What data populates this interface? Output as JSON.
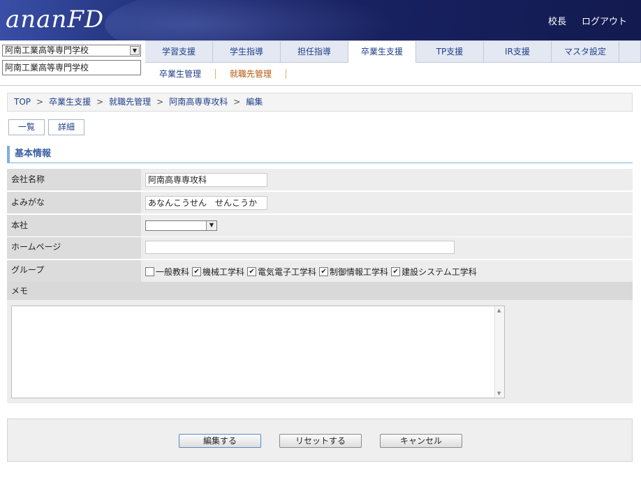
{
  "header": {
    "logo_text": "ananFD",
    "user_role": "校長",
    "logout": "ログアウト"
  },
  "school": {
    "selected": "阿南工業高等専門学校",
    "name_display": "阿南工業高等専門学校"
  },
  "nav": {
    "tabs": [
      {
        "label": "学習支援",
        "active": false
      },
      {
        "label": "学生指導",
        "active": false
      },
      {
        "label": "担任指導",
        "active": false
      },
      {
        "label": "卒業生支援",
        "active": true
      },
      {
        "label": "TP支援",
        "active": false
      },
      {
        "label": "IR支援",
        "active": false
      },
      {
        "label": "マスタ設定",
        "active": false
      }
    ],
    "subnav": [
      {
        "label": "卒業生管理",
        "current": false
      },
      {
        "label": "就職先管理",
        "current": true
      }
    ]
  },
  "breadcrumb": [
    "TOP",
    "卒業生支援",
    "就職先管理",
    "阿南高専専攻科",
    "編集"
  ],
  "view_buttons": {
    "list": "一覧",
    "detail": "詳細"
  },
  "section": {
    "title": "基本情報"
  },
  "form": {
    "company_name": {
      "label": "会社名称",
      "value": "阿南高専専攻科"
    },
    "reading": {
      "label": "よみがな",
      "value": "あなんこうせん　せんこうか"
    },
    "headquarters": {
      "label": "本社",
      "value": ""
    },
    "homepage": {
      "label": "ホームページ",
      "value": ""
    },
    "group": {
      "label": "グループ",
      "options": [
        {
          "label": "一般教科",
          "checked": false
        },
        {
          "label": "機械工学科",
          "checked": true
        },
        {
          "label": "電気電子工学科",
          "checked": true
        },
        {
          "label": "制御情報工学科",
          "checked": true
        },
        {
          "label": "建設システム工学科",
          "checked": true
        }
      ]
    },
    "memo": {
      "label": "メモ",
      "value": ""
    }
  },
  "actions": {
    "edit": "編集する",
    "reset": "リセットする",
    "cancel": "キャンセル"
  },
  "colors": {
    "header_dark": "#121a4f",
    "link": "#1f3f8a",
    "current_subnav": "#b8550a",
    "section_accent": "#7fb1dc"
  }
}
